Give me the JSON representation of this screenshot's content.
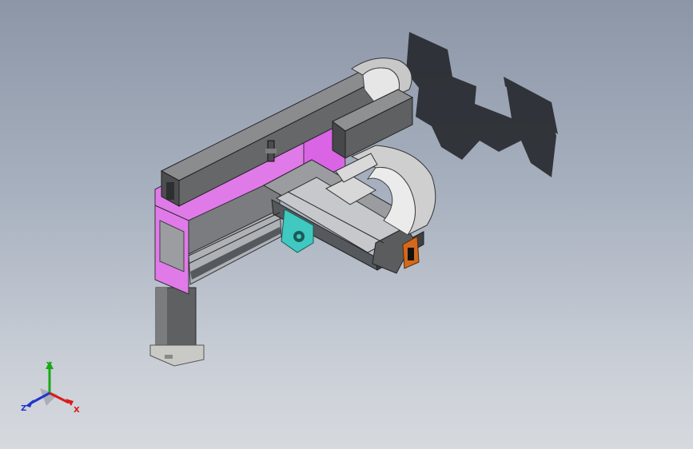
{
  "viewport": {
    "background_top": "#8c96a7",
    "background_bottom": "#d6d9de"
  },
  "model": {
    "part_colors": {
      "frame_plate": "#e07ae9",
      "steel_beam": "#6e7070",
      "cable_carrier": "#cfcfcf",
      "cast_bracket": "#3fc9c0",
      "limit_sensor": "#d2691e",
      "shadow": "#1e2024"
    }
  },
  "triad": {
    "x_label": "X",
    "y_label": "Y",
    "z_label": "Z",
    "x_color": "#d81b1b",
    "y_color": "#19a819",
    "z_color": "#2233cc"
  }
}
